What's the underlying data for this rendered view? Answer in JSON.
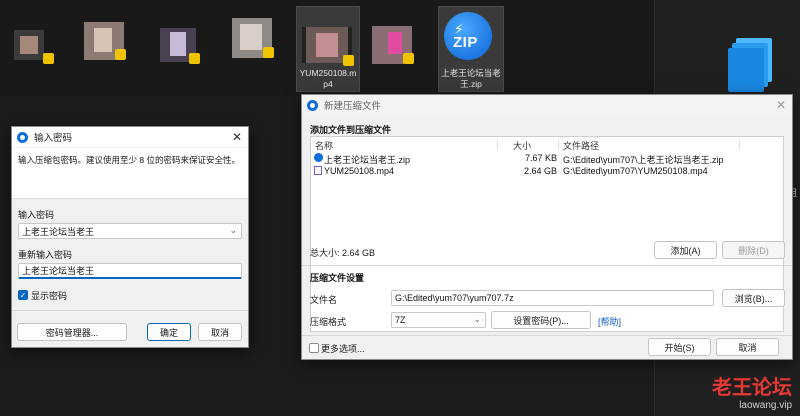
{
  "desktop": {
    "tiles": [
      {
        "label": "YUM250108.m\np4"
      },
      {
        "label": "上老王论坛当老\n王.zip"
      }
    ],
    "zip_icon_text": "ZIP",
    "edge_text": "组",
    "watermark": {
      "line1": "老王论坛",
      "line2": "laowang.vip"
    }
  },
  "password_dialog": {
    "title": "输入密码",
    "prompt": "输入压缩包密码。建议使用至少 8 位的密码来保证安全性。",
    "enter_label": "输入密码",
    "enter_value": "上老王论坛当老王",
    "reenter_label": "重新输入密码",
    "reenter_value": "上老王论坛当老王",
    "show_password_label": "显示密码",
    "show_password_checked": true,
    "manager_button": "密码管理器...",
    "ok_button": "确定",
    "cancel_button": "取消",
    "close_glyph": "✕"
  },
  "archive_dialog": {
    "title": "新建压缩文件",
    "add_section": "添加文件到压缩文件",
    "columns": {
      "name": "名称",
      "size": "大小",
      "path": "文件路径"
    },
    "files": [
      {
        "name": "上老王论坛当老王.zip",
        "size": "7.67 KB",
        "path": "G:\\Edited\\yum707\\上老王论坛当老王.zip",
        "type": "zip"
      },
      {
        "name": "YUM250108.mp4",
        "size": "2.64 GB",
        "path": "G:\\Edited\\yum707\\YUM250108.mp4",
        "type": "mp4"
      }
    ],
    "total_size": "总大小: 2.64 GB",
    "add_button": "添加(A)",
    "delete_button": "删除(D)",
    "settings_section": "压缩文件设置",
    "filename_label": "文件名",
    "filename_value": "G:\\Edited\\yum707\\yum707.7z",
    "browse_button": "浏览(B)...",
    "format_label": "压缩格式",
    "format_value": "7Z",
    "set_password_button": "设置密码(P)...",
    "help_link": "[帮助]",
    "more_options_label": "更多选项...",
    "start_button": "开始(S)",
    "cancel_button": "取消",
    "close_glyph": "✕"
  }
}
